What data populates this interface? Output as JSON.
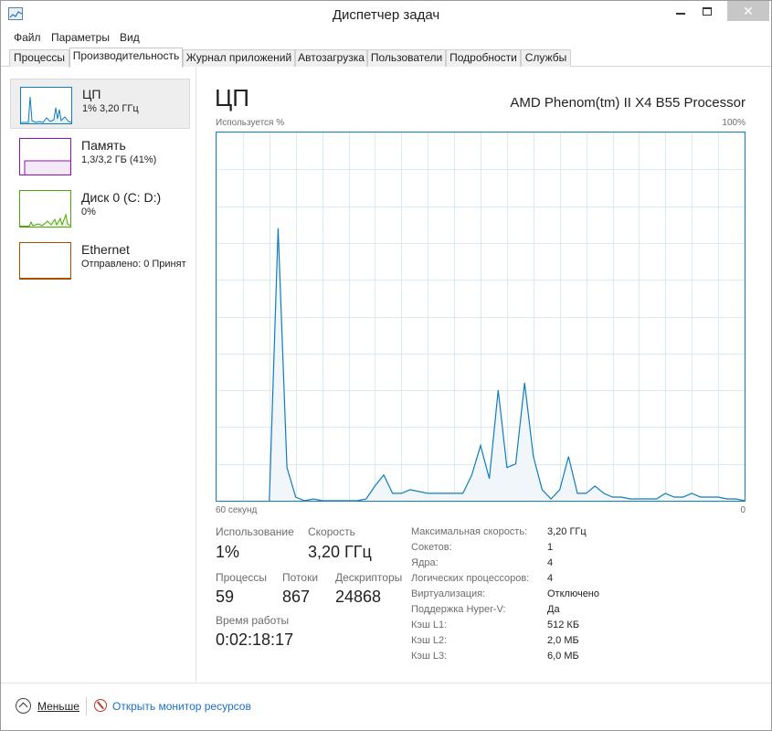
{
  "window": {
    "title": "Диспетчер задач",
    "close_glyph": "✕"
  },
  "menu": [
    "Файл",
    "Параметры",
    "Вид"
  ],
  "tabs": [
    "Процессы",
    "Производительность",
    "Журнал приложений",
    "Автозагрузка",
    "Пользователи",
    "Подробности",
    "Службы"
  ],
  "active_tab": "Производительность",
  "resources": [
    {
      "name": "ЦП",
      "sub": "1% 3,20 ГГц",
      "color": "#117dbb",
      "selected": true
    },
    {
      "name": "Память",
      "sub": "1,3/3,2 ГБ (41%)",
      "color": "#8b12ae",
      "selected": false
    },
    {
      "name": "Диск 0 (C: D:)",
      "sub": "0%",
      "color": "#4da60c",
      "selected": false
    },
    {
      "name": "Ethernet",
      "sub": "Отправлено: 0 Принят",
      "color": "#a74f01",
      "selected": false
    }
  ],
  "cpu": {
    "title": "ЦП",
    "model": "AMD Phenom(tm) II X4 B55 Processor",
    "y_label": "Используется %",
    "y_max_label": "100%",
    "x_left_label": "60 секунд",
    "x_right_label": "0",
    "line_color": "#117dbb",
    "fill_color": "#f1f6fa",
    "grid_color": "#d9eaf4"
  },
  "chart_data": {
    "type": "area",
    "title": "ЦП",
    "ylabel": "Используется %",
    "xlabel": "60 секунд",
    "ylim": [
      0,
      100
    ],
    "xlim": [
      60,
      0
    ],
    "grid": true,
    "x": [
      60,
      59,
      58,
      57,
      56,
      55,
      54,
      53,
      52,
      51,
      50,
      49,
      48,
      47,
      46,
      45,
      44,
      43,
      42,
      41,
      40,
      39,
      38,
      37,
      36,
      35,
      34,
      33,
      32,
      31,
      30,
      29,
      28,
      27,
      26,
      25,
      24,
      23,
      22,
      21,
      20,
      19,
      18,
      17,
      16,
      15,
      14,
      13,
      12,
      11,
      10,
      9,
      8,
      7,
      6,
      5,
      4,
      3,
      2,
      1,
      0
    ],
    "series": [
      {
        "values": [
          null,
          null,
          null,
          null,
          null,
          null,
          0,
          74,
          9,
          1,
          0,
          0.5,
          0,
          0,
          0,
          0,
          0,
          0.5,
          4,
          7,
          2,
          2,
          3,
          2.5,
          2,
          2,
          2,
          2,
          2,
          7,
          15,
          6,
          30,
          9,
          10,
          32,
          12,
          3,
          0.5,
          3,
          12,
          2,
          2,
          4,
          2,
          1,
          1,
          0.5,
          0.5,
          0.5,
          0.5,
          2,
          1,
          1,
          2,
          1,
          1,
          1,
          0.5,
          0.5,
          0
        ]
      }
    ]
  },
  "stats": {
    "usage_label": "Использование",
    "usage_value": "1%",
    "speed_label": "Скорость",
    "speed_value": "3,20 ГГц",
    "processes_label": "Процессы",
    "processes_value": "59",
    "threads_label": "Потоки",
    "threads_value": "867",
    "handles_label": "Дескрипторы",
    "handles_value": "24868",
    "uptime_label": "Время работы",
    "uptime_value": "0:02:18:17"
  },
  "specs": [
    {
      "label": "Максимальная скорость:",
      "value": "3,20 ГГц"
    },
    {
      "label": "Сокетов:",
      "value": "1"
    },
    {
      "label": "Ядра:",
      "value": "4"
    },
    {
      "label": "Логических процессоров:",
      "value": "4"
    },
    {
      "label": "Виртуализация:",
      "value": "Отключено"
    },
    {
      "label": "Поддержка Hyper-V:",
      "value": "Да"
    },
    {
      "label": "Кэш L1:",
      "value": "512 КБ"
    },
    {
      "label": "Кэш L2:",
      "value": "2,0 МБ"
    },
    {
      "label": "Кэш L3:",
      "value": "6,0 МБ"
    }
  ],
  "footer": {
    "less_label": "Меньше",
    "monitor_label": "Открыть монитор ресурсов"
  }
}
